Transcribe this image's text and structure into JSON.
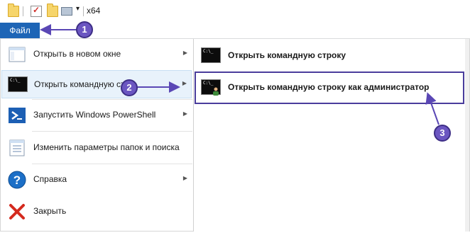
{
  "quick_access": {
    "title": "x64",
    "icons": [
      "folder-icon",
      "properties-icon",
      "new-folder-icon",
      "drive-icon",
      "customize-dropdown-icon"
    ]
  },
  "file_tab": {
    "label": "Файл"
  },
  "menu_left": {
    "items": [
      {
        "name": "open-new-window",
        "label": "Открыть в новом окне",
        "icon": "window-icon",
        "has_submenu": true
      },
      {
        "name": "open-command-prompt",
        "label": "Открыть командную стр",
        "icon": "cmd-icon",
        "has_submenu": true,
        "selected": true
      },
      {
        "name": "windows-powershell",
        "label": "Запустить Windows PowerShell",
        "icon": "powershell-icon",
        "has_submenu": true
      },
      {
        "name": "folder-options",
        "label": "Изменить параметры папок и поиска",
        "icon": "options-icon",
        "has_submenu": false
      },
      {
        "name": "help",
        "label": "Справка",
        "icon": "help-icon",
        "has_submenu": true
      },
      {
        "name": "close",
        "label": "Закрыть",
        "icon": "close-icon",
        "has_submenu": false
      }
    ]
  },
  "menu_right": {
    "items": [
      {
        "name": "open-cmd",
        "label": "Открыть командную строку",
        "icon": "cmd-icon"
      },
      {
        "name": "open-cmd-admin",
        "label": "Открыть командную строку как администратор",
        "icon": "cmd-admin-icon",
        "highlighted": true
      }
    ]
  },
  "callouts": [
    "1",
    "2",
    "3"
  ],
  "colors": {
    "accent": "#1e65b6",
    "callout": "#6b56c1",
    "callout_border": "#3d2e86",
    "hover": "#e8f2fb"
  }
}
